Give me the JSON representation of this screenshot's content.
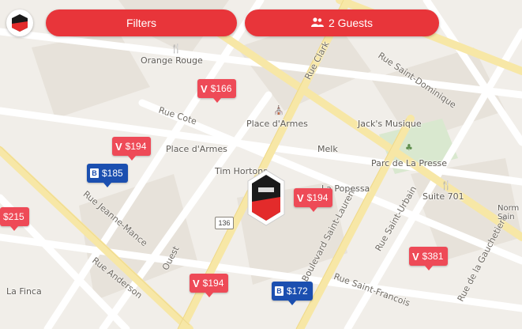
{
  "toolbar": {
    "filters_label": "Filters",
    "guests_label": "2 Guests",
    "guests_icon": "people-icon"
  },
  "map": {
    "streets": [
      "Rue Cote",
      "Rue Jeanne-Mance",
      "Rue Anderson",
      "Rue Saint-Urbain",
      "Rue Saint-Francois",
      "Rue de la Gauchetiere",
      "Rue Saint-Dominique",
      "Boulevard Saint-Laurent",
      "Rue Clark",
      "Ouest"
    ],
    "pois": [
      "Orange Rouge",
      "Place d'Armes",
      "Jack's Musique",
      "Melk",
      "Parc de La Presse",
      "Tim Hortons",
      "La Popessa",
      "Suite 701",
      "Norm Sain",
      "La Finca",
      "Place d'Armes"
    ],
    "route_number": "136"
  },
  "listings": [
    {
      "price": "$166",
      "source": "airbnb",
      "color": "#ee4a57"
    },
    {
      "price": "$194",
      "source": "airbnb",
      "color": "#ee4a57"
    },
    {
      "price": "$185",
      "source": "booking",
      "color": "#1b4fb0"
    },
    {
      "price": "$215",
      "source": "airbnb",
      "color": "#ee4a57"
    },
    {
      "price": "$194",
      "source": "airbnb",
      "color": "#ee4a57"
    },
    {
      "price": "$381",
      "source": "airbnb",
      "color": "#ee4a57"
    },
    {
      "price": "$194",
      "source": "airbnb",
      "color": "#ee4a57"
    },
    {
      "price": "$172",
      "source": "booking",
      "color": "#1b4fb0"
    }
  ],
  "colors": {
    "accent": "#e8353a",
    "airbnb_pin": "#ee4a57",
    "booking_pin": "#1b4fb0",
    "map_bg": "#f1eee9",
    "major_road": "#f7e7a6"
  }
}
